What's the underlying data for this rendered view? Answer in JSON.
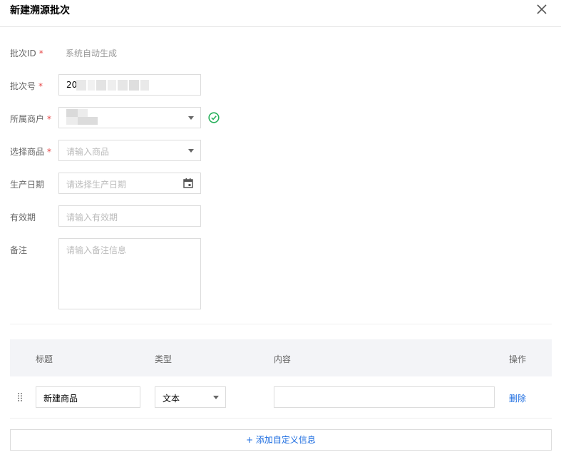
{
  "dialog": {
    "title": "新建溯源批次"
  },
  "form": {
    "batch_id": {
      "label": "批次ID",
      "required_mark": "*",
      "value": "系统自动生成"
    },
    "batch_no": {
      "label": "批次号",
      "required_mark": "*",
      "value": "20"
    },
    "merchant": {
      "label": "所属商户",
      "required_mark": "*",
      "value": ""
    },
    "product": {
      "label": "选择商品",
      "required_mark": "*",
      "placeholder": "请输入商品"
    },
    "production_date": {
      "label": "生产日期",
      "placeholder": "请选择生产日期"
    },
    "validity": {
      "label": "有效期",
      "placeholder": "请输入有效期"
    },
    "remark": {
      "label": "备注",
      "placeholder": "请输入备注信息"
    }
  },
  "table": {
    "headers": {
      "title": "标题",
      "type": "类型",
      "content": "内容",
      "action": "操作"
    },
    "rows": [
      {
        "title": "新建商品",
        "type": "文本",
        "content": "",
        "action": "删除"
      }
    ]
  },
  "add_button": {
    "label": "+ 添加自定义信息"
  },
  "colors": {
    "accent": "#1a6be0",
    "required": "#e54545",
    "success": "#27b05b"
  },
  "icons": {
    "close": "close-icon",
    "check": "check-circle-icon",
    "calendar": "calendar-icon",
    "drag": "drag-handle-icon",
    "dropdown": "chevron-down-icon"
  }
}
